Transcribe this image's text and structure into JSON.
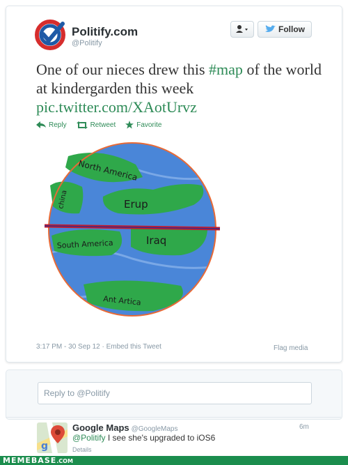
{
  "tweet": {
    "author": {
      "name": "Politify.com",
      "handle": "@Politify"
    },
    "follow_label": "Follow",
    "text_part1": "One of our nieces drew this ",
    "hashtag": "#map",
    "text_part2": " of the world at kindergarden this week",
    "link": "pic.twitter.com/XAotUrvz",
    "actions": {
      "reply": "Reply",
      "retweet": "Retweet",
      "favorite": "Favorite"
    },
    "map_labels": {
      "north_america": "North America",
      "china": "china",
      "erup": "Erup",
      "south_america": "South America",
      "iraq": "Iraq",
      "antartica": "Ant Artica"
    },
    "meta": {
      "time": "3:17 PM - 30 Sep 12",
      "embed": "Embed this Tweet"
    },
    "flag_label": "Flag media"
  },
  "reply_box": {
    "placeholder": "Reply to @Politify"
  },
  "reply": {
    "author": {
      "name": "Google Maps",
      "handle": "@GoogleMaps"
    },
    "time": "6m",
    "mention": "@Politify",
    "text": " I see she's upgraded to iOS6",
    "details_label": "Details"
  },
  "watermark": {
    "text": "MEMEBASE",
    "suffix": ".COM"
  },
  "colors": {
    "link": "#2e8b57",
    "watermark_bg": "#1b8d4d"
  }
}
